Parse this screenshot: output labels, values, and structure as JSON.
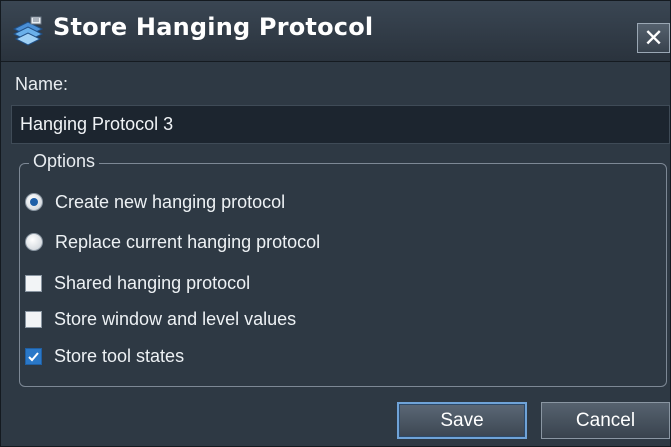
{
  "window": {
    "title": "Store Hanging Protocol",
    "icon": "protocol-stack-icon",
    "close_label": "✕"
  },
  "name": {
    "label": "Name:",
    "value": "Hanging Protocol 3"
  },
  "options": {
    "legend": "Options",
    "items": [
      {
        "type": "radio",
        "label": "Create new hanging protocol",
        "checked": true
      },
      {
        "type": "radio",
        "label": "Replace current hanging protocol",
        "checked": false
      },
      {
        "type": "checkbox",
        "label": "Shared hanging protocol",
        "checked": false
      },
      {
        "type": "checkbox",
        "label": "Store window and level values",
        "checked": false
      },
      {
        "type": "checkbox",
        "label": "Store tool states",
        "checked": true
      }
    ]
  },
  "buttons": {
    "save_label": "Save",
    "cancel_label": "Cancel"
  },
  "colors": {
    "background": "#2e3944",
    "accent": "#2a78c8",
    "text": "#edf1f4"
  }
}
